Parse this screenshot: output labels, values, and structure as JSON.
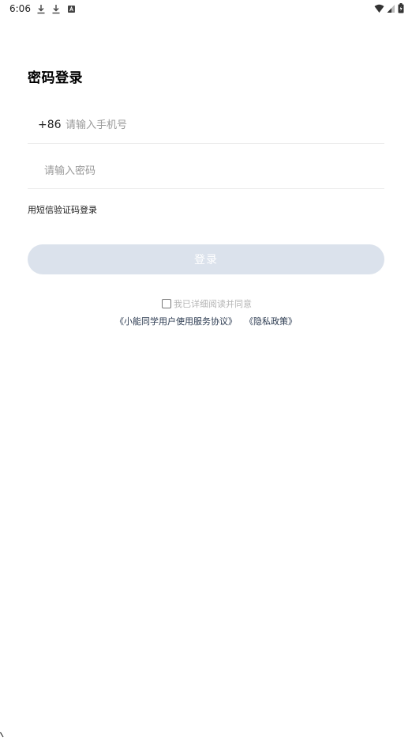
{
  "status_bar": {
    "time": "6:06",
    "left_icons": [
      "download-icon",
      "download-icon",
      "a-notification-icon"
    ],
    "right_icons": [
      "wifi-icon",
      "cell-signal-icon",
      "battery-icon"
    ]
  },
  "login": {
    "title": "密码登录",
    "phone": {
      "country_code": "+86",
      "placeholder": "请输入手机号",
      "value": ""
    },
    "password": {
      "placeholder": "请输入密码",
      "value": ""
    },
    "sms_login_label": "用短信验证码登录",
    "login_button_label": "登录",
    "agree_text": "我已详细阅读并同意",
    "agree_checked": false,
    "user_agreement_label": "《小能同学用户使用服务协议》",
    "privacy_policy_label": "《隐私政策》"
  },
  "colors": {
    "button_disabled": "#dbe2ec",
    "link": "#2b3a50",
    "hint": "#9a9a9a"
  }
}
